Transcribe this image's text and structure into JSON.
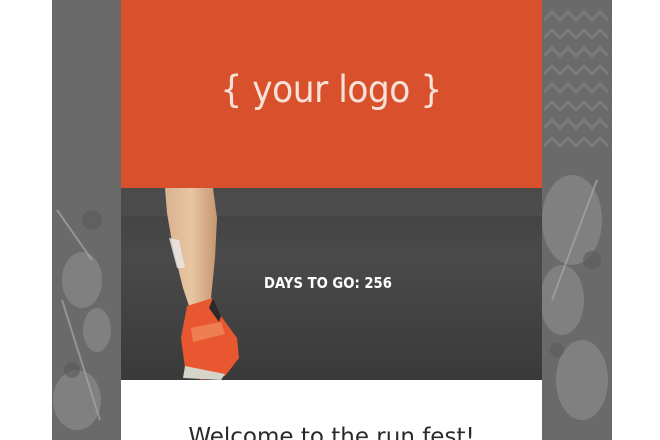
{
  "header": {
    "logo_text": "{ your logo }"
  },
  "hero": {
    "countdown_text": "DAYS TO GO: 256"
  },
  "welcome": {
    "heading": "Welcome to the run fest!"
  },
  "colors": {
    "brand_accent": "#d9512c",
    "background_band": "#6b6b6b",
    "logo_text": "#f6e2d8",
    "countdown_text": "#ffffff",
    "panel": "#ffffff",
    "shoe": "#e8572f"
  }
}
